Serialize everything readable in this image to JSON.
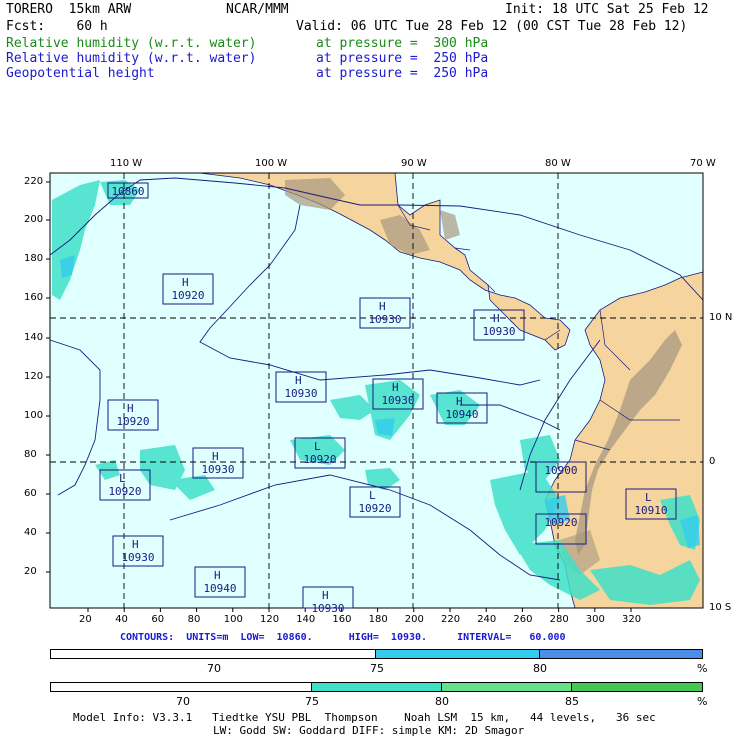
{
  "header": {
    "model": "TORERO  15km ARW",
    "org": "NCAR/MMM",
    "init": "Init: 18 UTC Sat 25 Feb 12",
    "fcst": "Fcst:    60 h",
    "valid": "Valid: 06 UTC Tue 28 Feb 12 (00 CST Tue 28 Feb 12)",
    "fields": [
      {
        "name": "Relative humidity (w.r.t. water)",
        "level": "at pressure =  300 hPa",
        "color": "#1a8a1a"
      },
      {
        "name": "Relative humidity (w.r.t. water)",
        "level": "at pressure =  250 hPa",
        "color": "#1a1ad0"
      },
      {
        "name": "Geopotential height",
        "level": "at pressure =  250 hPa",
        "color": "#1a1ad0"
      }
    ]
  },
  "axes": {
    "top_lon": [
      "110 W",
      "100 W",
      "90 W",
      "80 W",
      "70 W"
    ],
    "right_lat": [
      "10 N",
      "0",
      "10 S"
    ],
    "left_y": [
      "220",
      "200",
      "180",
      "160",
      "140",
      "120",
      "100",
      "80",
      "60",
      "40",
      "20"
    ],
    "bottom_x": [
      "20",
      "40",
      "60",
      "80",
      "100",
      "120",
      "140",
      "160",
      "180",
      "200",
      "220",
      "240",
      "260",
      "280",
      "300",
      "320"
    ]
  },
  "pressure_labels": [
    {
      "type": "",
      "value": "10860"
    },
    {
      "type": "H",
      "value": "10920"
    },
    {
      "type": "H",
      "value": "10930"
    },
    {
      "type": "H",
      "value": "10930"
    },
    {
      "type": "H",
      "value": "10930"
    },
    {
      "type": "H",
      "value": "10930"
    },
    {
      "type": "H",
      "value": "10940"
    },
    {
      "type": "H",
      "value": "10920"
    },
    {
      "type": "L",
      "value": "10920"
    },
    {
      "type": "H",
      "value": "10930"
    },
    {
      "type": "L",
      "value": "10920"
    },
    {
      "type": "L",
      "value": "10920"
    },
    {
      "type": "",
      "value": "10900"
    },
    {
      "type": "",
      "value": "10920"
    },
    {
      "type": "L",
      "value": "10910"
    },
    {
      "type": "H",
      "value": "10930"
    },
    {
      "type": "H",
      "value": "10940"
    },
    {
      "type": "H",
      "value": "10930"
    },
    {
      "type": "H",
      "value": ""
    }
  ],
  "contour_info": "CONTOURS:  UNITS=m  LOW=  10860.      HIGH=  10930.     INTERVAL=   60.000",
  "colorbars": [
    {
      "labels": [
        "70",
        "75",
        "80"
      ],
      "unit": "%",
      "colors": [
        "#ffffff",
        "#33ccee",
        "#4b8fe8"
      ]
    },
    {
      "labels": [
        "70",
        "75",
        "80",
        "85"
      ],
      "unit": "%",
      "colors": [
        "#ffffff",
        "#40e0c8",
        "#66e08a",
        "#44c855"
      ]
    }
  ],
  "footer": [
    "Model Info: V3.3.1   Tiedtke YSU PBL  Thompson    Noah LSM  15 km,   44 levels,   36 sec",
    "LW: Godd SW: Goddard DIFF: simple KM: 2D Smagor"
  ],
  "colors": {
    "ocean": "#e0ffff",
    "land": "#f5d49e",
    "terrain": "#a89880",
    "contour": "#1a1a80",
    "grid": "#000000"
  }
}
